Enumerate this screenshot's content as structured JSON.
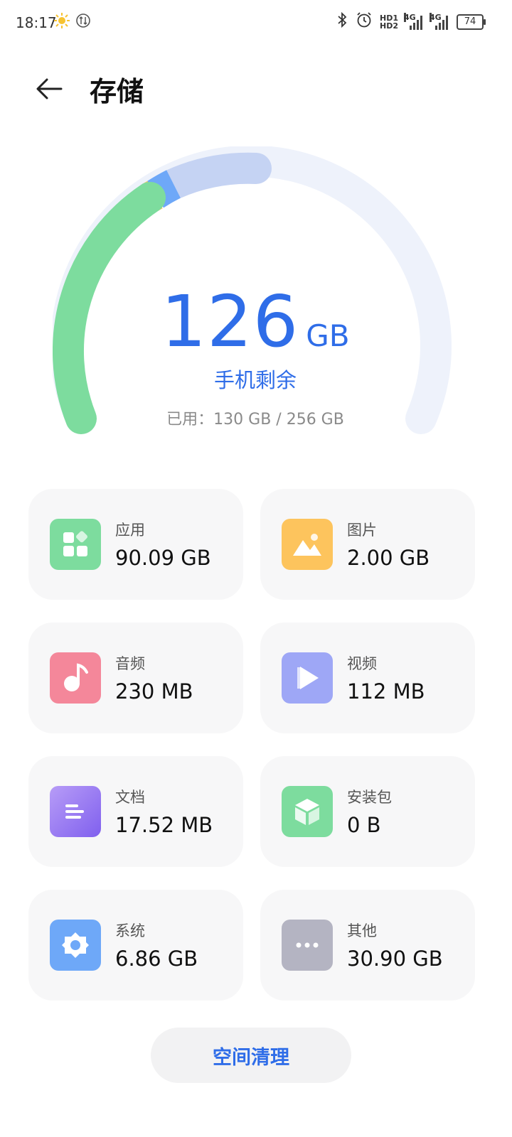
{
  "status_bar": {
    "time": "18:17",
    "hd1": "HD1",
    "hd2": "HD2",
    "net1": "4G",
    "net2": "4G",
    "battery": "74"
  },
  "header": {
    "title": "存储"
  },
  "storage": {
    "free_value": "126",
    "free_unit": "GB",
    "free_label": "手机剩余",
    "used_text": "已用：130 GB / 256 GB"
  },
  "categories": [
    {
      "name": "应用",
      "size": "90.09 GB",
      "icon": "apps-icon",
      "color": "#7ddc9e"
    },
    {
      "name": "图片",
      "size": "2.00 GB",
      "icon": "image-icon",
      "color": "#fdc45d"
    },
    {
      "name": "音频",
      "size": "230 MB",
      "icon": "music-icon",
      "color": "#f4879a"
    },
    {
      "name": "视频",
      "size": "112 MB",
      "icon": "video-icon",
      "color": "#9ea7f6"
    },
    {
      "name": "文档",
      "size": "17.52 MB",
      "icon": "document-icon",
      "color": "#9a7cf3"
    },
    {
      "name": "安装包",
      "size": "0 B",
      "icon": "package-icon",
      "color": "#7ddc9e"
    },
    {
      "name": "系统",
      "size": "6.86 GB",
      "icon": "system-gear-icon",
      "color": "#6ea8f8"
    },
    {
      "name": "其他",
      "size": "30.90 GB",
      "icon": "more-icon",
      "color": "#b4b4c2"
    }
  ],
  "actions": {
    "clean_label": "空间清理"
  },
  "colors": {
    "accent": "#2f6de8",
    "gauge_track": "#eef2fb",
    "apps": "#7ddc9e",
    "images": "#fdc45d",
    "system": "#6ea8f8",
    "other": "#c5d3f3"
  }
}
